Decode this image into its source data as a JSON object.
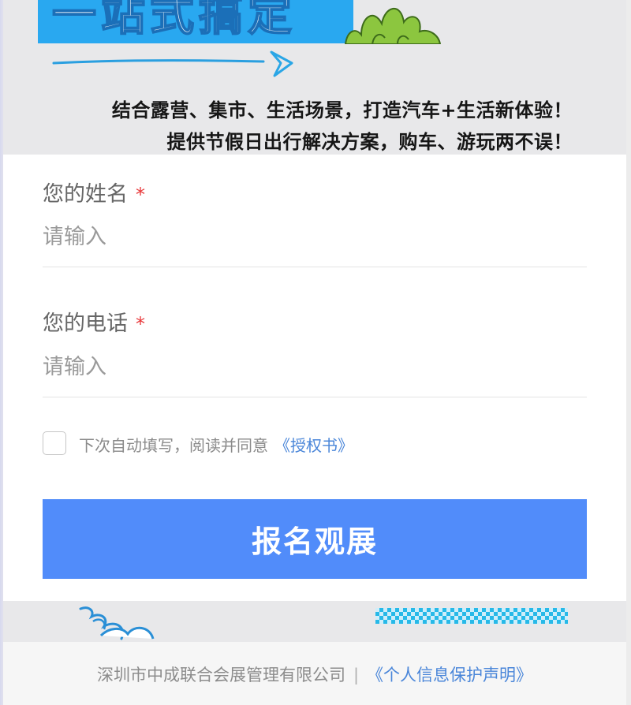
{
  "banner": {
    "headline": "一站式搞定",
    "slogan_line1": "结合露营、集市、生活场景，打造汽车+生活新体验！",
    "slogan_line2": "提供节假日出行解决方案，购车、游玩两不误！"
  },
  "form": {
    "name_label": "您的姓名",
    "name_required_mark": "*",
    "name_placeholder": "请输入",
    "phone_label": "您的电话",
    "phone_required_mark": "*",
    "phone_placeholder": "请输入",
    "agree_text": "下次自动填写，阅读并同意",
    "agree_link": "《授权书》",
    "submit_label": "报名观展"
  },
  "footer": {
    "company": "深圳市中成联合会展管理有限公司",
    "separator": "|",
    "policy_link": "《个人信息保护声明》"
  },
  "colors": {
    "accent": "#518cfa",
    "link": "#4a86d9",
    "required": "#e8393b",
    "headline_bg": "#29a8f0"
  },
  "icons": [
    "bush-decoration-icon",
    "arrow-decoration-icon",
    "swirl-decoration-icon",
    "checkbox-icon"
  ]
}
